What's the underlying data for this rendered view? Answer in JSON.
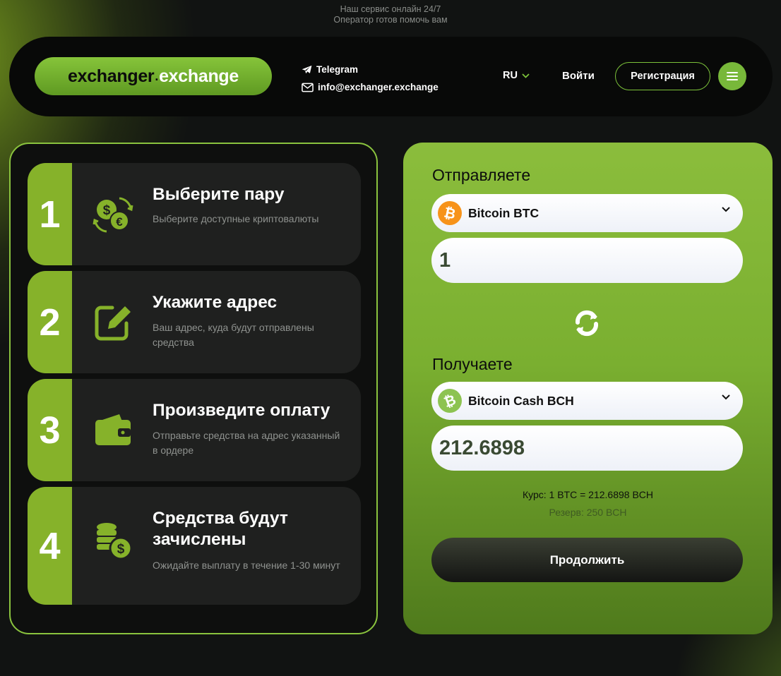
{
  "top_note": {
    "line1": "Наш сервис онлайн 24/7",
    "line2": "Оператор готов помочь вам"
  },
  "header": {
    "logo_part1": "exchanger",
    "logo_dot": ".",
    "logo_part2": "exchange",
    "telegram": "Telegram",
    "email": "info@exchanger.exchange",
    "language": "RU",
    "login": "Войти",
    "register": "Регистрация"
  },
  "steps": [
    {
      "number": "1",
      "title": "Выберите пару",
      "desc": "Выберите доступные криптовалюты"
    },
    {
      "number": "2",
      "title": "Укажите адрес",
      "desc": "Ваш адрес, куда будут отправлены средства"
    },
    {
      "number": "3",
      "title": "Произведите оплату",
      "desc": "Отправьте средства на адрес указанный в ордере"
    },
    {
      "number": "4",
      "title": "Средства будут зачислены",
      "desc": "Ожидайте выплату в течение 1-30 минут"
    }
  ],
  "exchange": {
    "send_label": "Отправляете",
    "send_currency": "Bitcoin BTC",
    "send_amount": "1",
    "receive_label": "Получаете",
    "receive_currency": "Bitcoin Cash BCH",
    "receive_amount": "212.6898",
    "rate": "Курс: 1 BTC = 212.6898 BCH",
    "reserve": "Резерв: 250 BCH",
    "continue": "Продолжить"
  },
  "colors": {
    "accent": "#86b22a",
    "btc": "#f7931a",
    "bch": "#8dc351",
    "panel": "#1f201f"
  }
}
